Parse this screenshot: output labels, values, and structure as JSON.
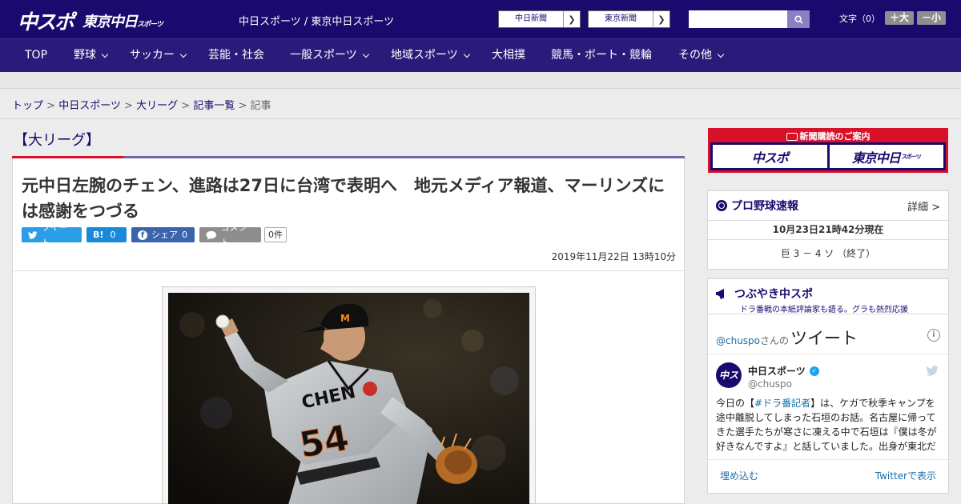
{
  "header": {
    "logo_chuspo": "中スポ",
    "logo_tokyo": "東京中日",
    "logo_tokyo_sub": "スポーツ",
    "site_names": "中日スポーツ / 東京中日スポーツ",
    "paper_links": [
      {
        "label": "中日新聞"
      },
      {
        "label": "東京新聞"
      }
    ],
    "search_placeholder": "",
    "font_size_label": "文字（0）",
    "font_plus": "＋大",
    "font_minus": "－小"
  },
  "nav": {
    "items": [
      {
        "label": "TOP",
        "dropdown": false
      },
      {
        "label": "野球",
        "dropdown": true
      },
      {
        "label": "サッカー",
        "dropdown": true
      },
      {
        "label": "芸能・社会",
        "dropdown": false
      },
      {
        "label": "一般スポーツ",
        "dropdown": true
      },
      {
        "label": "地域スポーツ",
        "dropdown": true
      },
      {
        "label": "大相撲",
        "dropdown": false
      },
      {
        "label": "競馬・ボート・競輪",
        "dropdown": false
      },
      {
        "label": "その他",
        "dropdown": true
      }
    ]
  },
  "breadcrumb": {
    "items": [
      "トップ",
      "中日スポーツ",
      "大リーグ",
      "記事一覧"
    ],
    "current": "記事",
    "separator": ">"
  },
  "article": {
    "category": "【大リーグ】",
    "headline": "元中日左腕のチェン、進路は27日に台湾で表明へ　地元メディア報道、マーリンズには感謝をつづる",
    "share": {
      "tweet": "ツイート",
      "hatena": "B!",
      "hatena_count": "0",
      "facebook": "シェア",
      "facebook_count": "0",
      "comment": "コメント",
      "comment_count": "0件"
    },
    "date": "2019年11月22日 13時10分",
    "photo_jersey": "CHEN",
    "photo_number": "54"
  },
  "sidebar": {
    "subscription": {
      "title": "新聞購読のご案内",
      "card1": "中スポ",
      "card2": "東京中日",
      "card2_sub": "スポーツ"
    },
    "baseball": {
      "title": "プロ野球速報",
      "more": "詳細 >",
      "timestamp": "10月23日21時42分現在",
      "score": "巨 3 － 4 ソ （終了）"
    },
    "twitter": {
      "title": "つぶやき中スポ",
      "subtitle": "ドラ番戦の本紙評論家も語る。グラも熱烈応援",
      "handle": "@chuspo",
      "san": "さんの",
      "tweet_label": "ツイート",
      "account_name": "中日スポーツ",
      "account_user": "@chuspo",
      "avatar_text": "中スポ",
      "body_pre": "今日の【",
      "body_tag": "#ドラ番記者",
      "body_post": "】は、ケガで秋季キャンプを途中離脱してしまった石垣のお話。名古屋に帰ってきた選手たちが寒さに凍える中で石垣は『僕は冬が好きなんですよ』と話していました。出身が東北だ",
      "embed": "埋め込む",
      "view_on_twitter": "Twitterで表示"
    }
  },
  "colors": {
    "brand_navy": "#1a0a6e",
    "nav_bg": "#2a1a7a",
    "accent_red": "#d8112b",
    "twitter_blue": "#2a9ee6"
  }
}
